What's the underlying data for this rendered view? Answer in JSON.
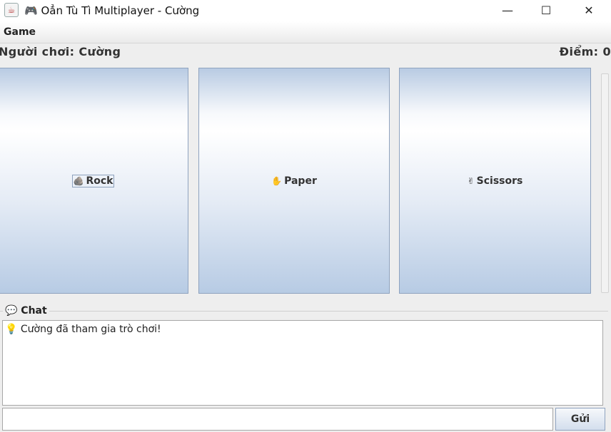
{
  "window": {
    "title": "🎮 Oẳn Tù Tì Multiplayer - Cường",
    "app_icon": "java-icon",
    "controls": {
      "minimize": "—",
      "maximize": "☐",
      "close": "✕"
    }
  },
  "menubar": {
    "items": [
      {
        "label": "Game"
      }
    ]
  },
  "status": {
    "player": "Người chơi: Cường",
    "score": "Điểm: 0"
  },
  "choices": [
    {
      "id": "rock",
      "icon_glyph": "🪨",
      "label": "Rock"
    },
    {
      "id": "paper",
      "icon_glyph": "✋",
      "label": "Paper"
    },
    {
      "id": "scissors",
      "icon_glyph": "✌",
      "label": "Scissors"
    }
  ],
  "chat": {
    "title": "💬 Chat",
    "messages": [
      {
        "icon_glyph": "💡",
        "text": "Cường đã tham gia trò chơi!"
      }
    ],
    "input_value": "",
    "send_label": "Gửi"
  }
}
